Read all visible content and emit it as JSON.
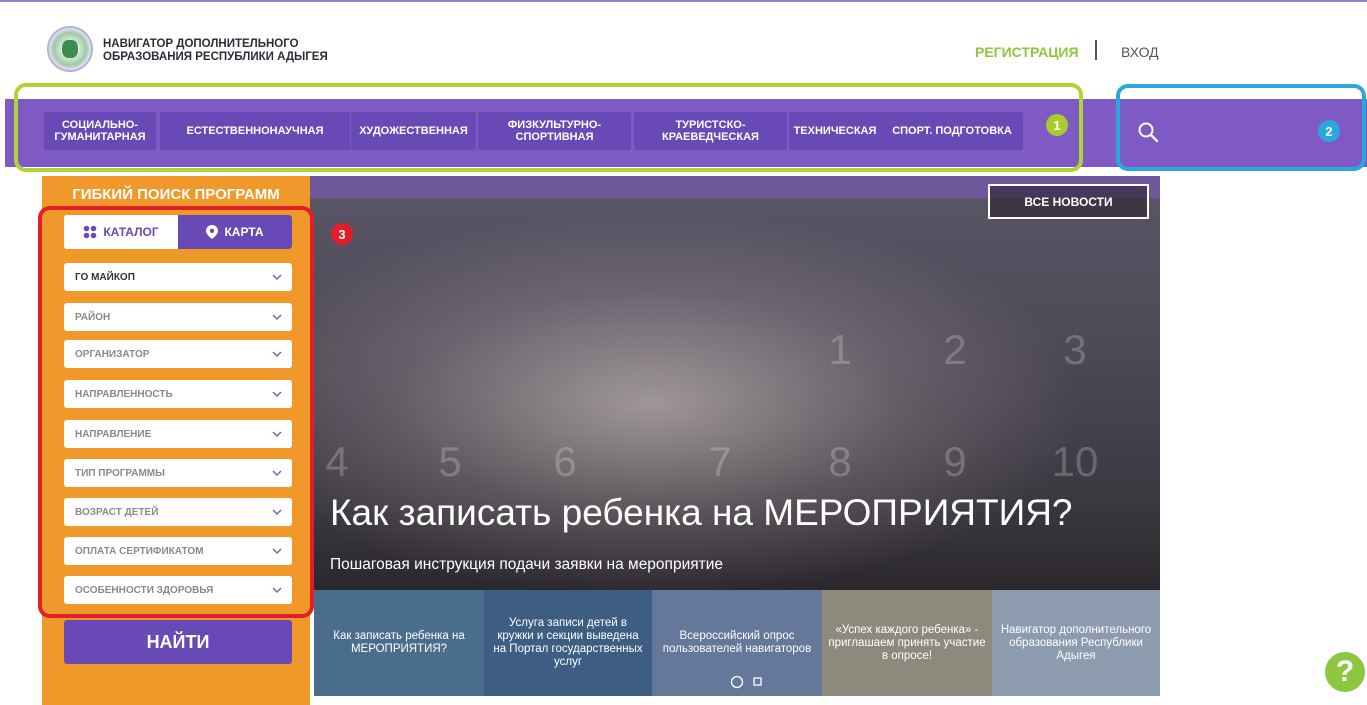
{
  "header": {
    "logo_line1": "НАВИГАТОР ДОПОЛНИТЕЛЬНОГО",
    "logo_line2": "ОБРАЗОВАНИЯ РЕСПУБЛИКИ АДЫГЕЯ",
    "register": "РЕГИСТРАЦИЯ",
    "login": "ВХОД"
  },
  "nav": {
    "items": [
      {
        "line1": "СОЦИАЛЬНО-",
        "line2": "ГУМАНИТАРНАЯ"
      },
      {
        "line1": "ЕСТЕСТВЕННОНАУЧНАЯ",
        "line2": ""
      },
      {
        "line1": "ХУДОЖЕСТВЕННАЯ",
        "line2": ""
      },
      {
        "line1": "ФИЗКУЛЬТУРНО-",
        "line2": "СПОРТИВНАЯ"
      },
      {
        "line1": "ТУРИСТСКО-",
        "line2": "КРАЕВЕДЧЕСКАЯ"
      },
      {
        "line1": "ТЕХНИЧЕСКАЯ",
        "line2": ""
      },
      {
        "line1": "СПОРТ. ПОДГОТОВКА",
        "line2": ""
      }
    ]
  },
  "badges": {
    "one": "1",
    "two": "2",
    "three": "3"
  },
  "filter": {
    "title": "ГИБКИЙ ПОИСК ПРОГРАММ",
    "tab_catalog": "КАТАЛОГ",
    "tab_map": "КАРТА",
    "selects": [
      "ГО МАЙКОП",
      "РАЙОН",
      "ОРГАНИЗАТОР",
      "НАПРАВЛЕННОСТЬ",
      "НАПРАВЛЕНИЕ",
      "ТИП ПРОГРАММЫ",
      "ВОЗРАСТ ДЕТЕЙ",
      "ОПЛАТА СЕРТИФИКАТОМ",
      "ОСОБЕННОСТИ ЗДОРОВЬЯ"
    ],
    "find": "НАЙТИ"
  },
  "banner": {
    "all_news": "ВСЕ НОВОСТИ",
    "title": "Как записать ребенка на МЕРОПРИЯТИЯ?",
    "subtitle": "Пошаговая инструкция подачи заявки на мероприятие"
  },
  "thumbs": [
    {
      "text": "Как записать ребенка на МЕРОПРИЯТИЯ?"
    },
    {
      "text": "Услуга записи детей в кружки и секции выведена на Портал государственных услуг"
    },
    {
      "text": "Всероссийский опрос пользователей навигаторов"
    },
    {
      "text": "«Успех каждого ребенка» - приглашаем принять участие в опросе!"
    },
    {
      "text": "Навигатор дополнительного образования Республики Адыгея"
    }
  ],
  "help": "?",
  "colors": {
    "purple": "#7f5ac4",
    "purple_dark": "#6949b5",
    "orange": "#f0982a",
    "green": "#8dc63f",
    "blue": "#29a8e0",
    "red": "#e21f26"
  }
}
